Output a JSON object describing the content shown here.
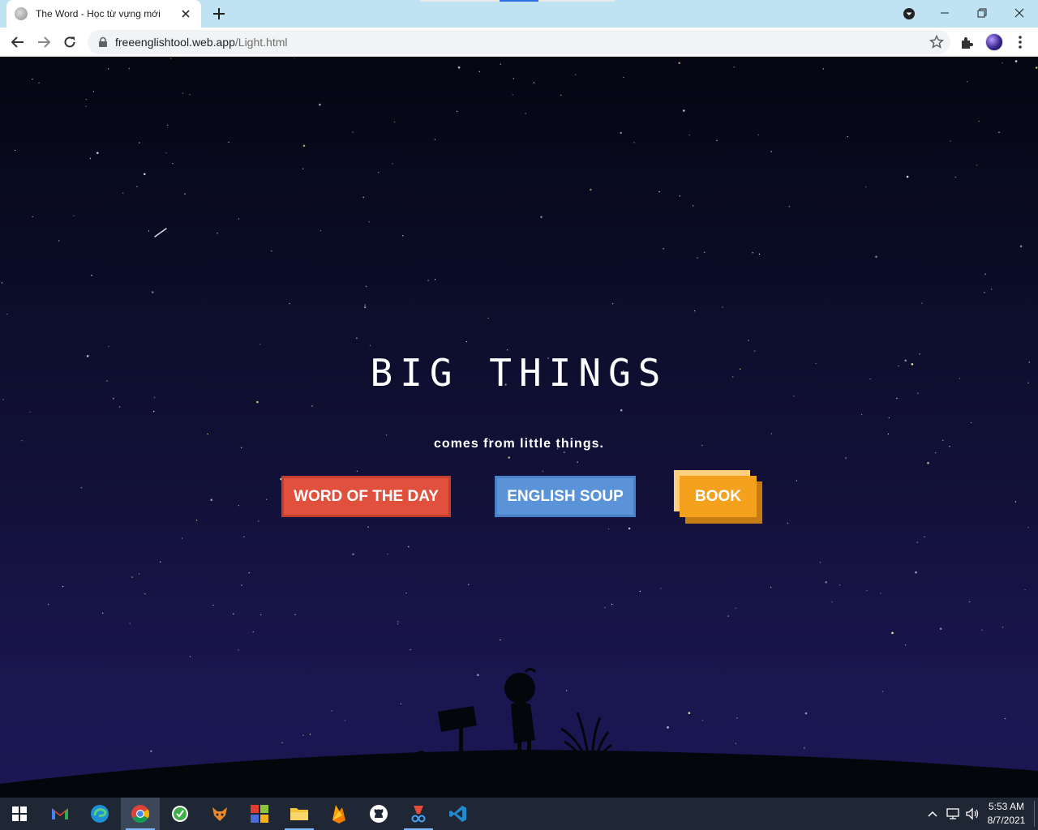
{
  "browser": {
    "tab_title": "The Word - Học từ vựng mới",
    "url_domain": "freeenglishtool.web.app",
    "url_path": "/Light.html"
  },
  "page": {
    "headline": "BIG THINGS",
    "tagline": "comes from little things.",
    "buttons": {
      "word_of_the_day": "WORD OF THE DAY",
      "english_soup": "ENGLISH SOUP",
      "book": "BOOK"
    },
    "colors": {
      "sky_top": "#050612",
      "sky_bottom": "#1b1752",
      "word_button": "#e0503c",
      "soup_button": "#5b93d8",
      "book_button": "#f4a11e"
    }
  },
  "taskbar": {
    "apps": [
      "start-icon",
      "gmail-icon",
      "edge-icon",
      "chrome-icon",
      "app-green-icon",
      "app-fox-icon",
      "app-squares-icon",
      "file-explorer-icon",
      "firebase-icon",
      "github-icon",
      "app-scissors-icon",
      "vscode-icon"
    ],
    "time": "5:53 AM",
    "date": "8/7/2021"
  }
}
